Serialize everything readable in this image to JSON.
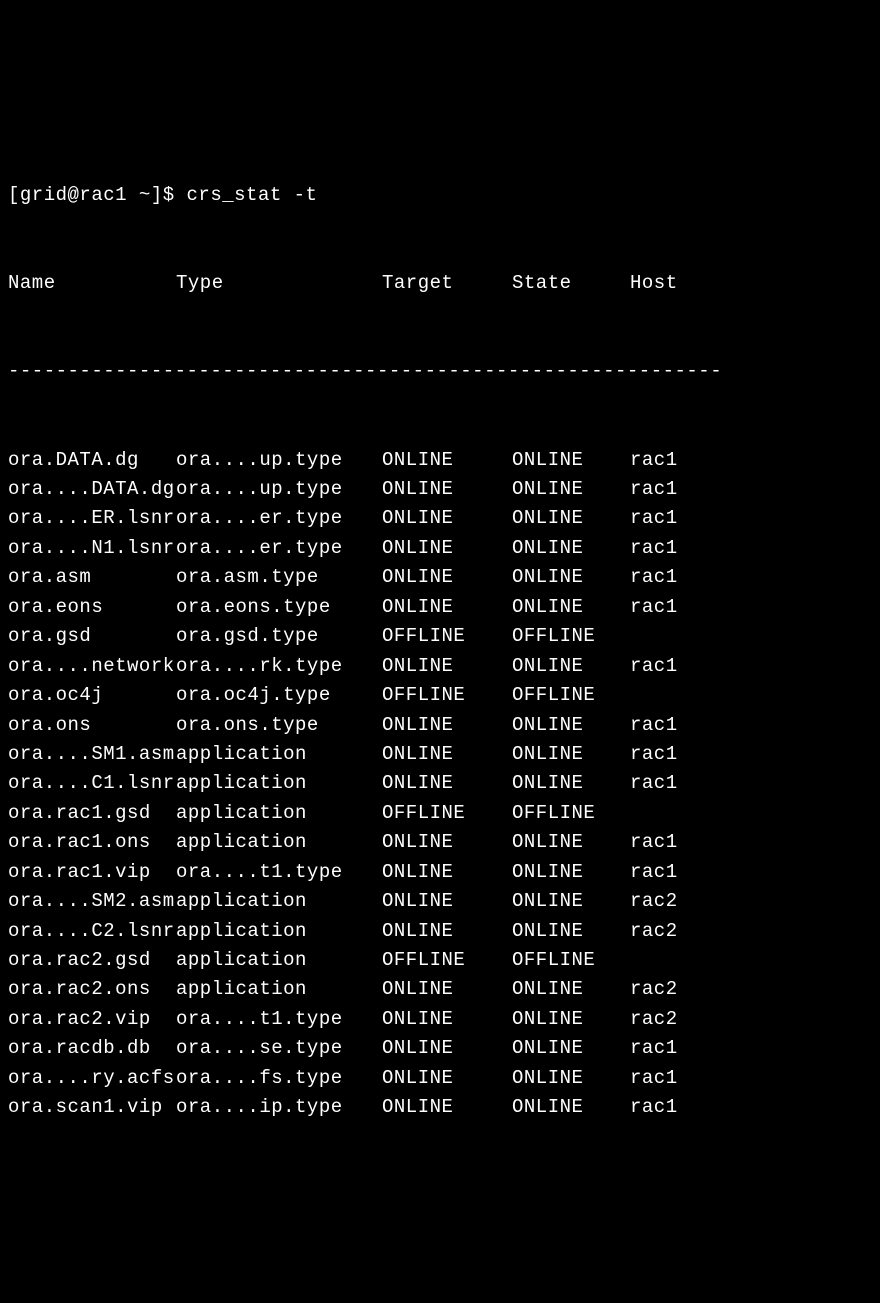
{
  "prompt": "[grid@rac1 ~]$ crs_stat -t",
  "headers": {
    "name": "Name",
    "type": "Type",
    "target": "Target",
    "state": "State",
    "host": "Host"
  },
  "divider": "------------------------------------------------------------",
  "rows": [
    {
      "name": "ora.DATA.dg",
      "type": "ora....up.type",
      "target": "ONLINE",
      "state": "ONLINE",
      "host": "rac1"
    },
    {
      "name": "ora....DATA.dg",
      "type": "ora....up.type",
      "target": "ONLINE",
      "state": "ONLINE",
      "host": "rac1"
    },
    {
      "name": "ora....ER.lsnr",
      "type": "ora....er.type",
      "target": "ONLINE",
      "state": "ONLINE",
      "host": "rac1"
    },
    {
      "name": "ora....N1.lsnr",
      "type": "ora....er.type",
      "target": "ONLINE",
      "state": "ONLINE",
      "host": "rac1"
    },
    {
      "name": "ora.asm",
      "type": "ora.asm.type",
      "target": "ONLINE",
      "state": "ONLINE",
      "host": "rac1"
    },
    {
      "name": "ora.eons",
      "type": "ora.eons.type",
      "target": "ONLINE",
      "state": "ONLINE",
      "host": "rac1"
    },
    {
      "name": "ora.gsd",
      "type": "ora.gsd.type",
      "target": "OFFLINE",
      "state": "OFFLINE",
      "host": ""
    },
    {
      "name": "ora....network",
      "type": "ora....rk.type",
      "target": "ONLINE",
      "state": "ONLINE",
      "host": "rac1"
    },
    {
      "name": "ora.oc4j",
      "type": "ora.oc4j.type",
      "target": "OFFLINE",
      "state": "OFFLINE",
      "host": ""
    },
    {
      "name": "ora.ons",
      "type": "ora.ons.type",
      "target": "ONLINE",
      "state": "ONLINE",
      "host": "rac1"
    },
    {
      "name": "ora....SM1.asm",
      "type": "application",
      "target": "ONLINE",
      "state": "ONLINE",
      "host": "rac1"
    },
    {
      "name": "ora....C1.lsnr",
      "type": "application",
      "target": "ONLINE",
      "state": "ONLINE",
      "host": "rac1"
    },
    {
      "name": "ora.rac1.gsd",
      "type": "application",
      "target": "OFFLINE",
      "state": "OFFLINE",
      "host": ""
    },
    {
      "name": "ora.rac1.ons",
      "type": "application",
      "target": "ONLINE",
      "state": "ONLINE",
      "host": "rac1"
    },
    {
      "name": "ora.rac1.vip",
      "type": "ora....t1.type",
      "target": "ONLINE",
      "state": "ONLINE",
      "host": "rac1"
    },
    {
      "name": "ora....SM2.asm",
      "type": "application",
      "target": "ONLINE",
      "state": "ONLINE",
      "host": "rac2"
    },
    {
      "name": "ora....C2.lsnr",
      "type": "application",
      "target": "ONLINE",
      "state": "ONLINE",
      "host": "rac2"
    },
    {
      "name": "ora.rac2.gsd",
      "type": "application",
      "target": "OFFLINE",
      "state": "OFFLINE",
      "host": ""
    },
    {
      "name": "ora.rac2.ons",
      "type": "application",
      "target": "ONLINE",
      "state": "ONLINE",
      "host": "rac2"
    },
    {
      "name": "ora.rac2.vip",
      "type": "ora....t1.type",
      "target": "ONLINE",
      "state": "ONLINE",
      "host": "rac2"
    },
    {
      "name": "ora.racdb.db",
      "type": "ora....se.type",
      "target": "ONLINE",
      "state": "ONLINE",
      "host": "rac1"
    },
    {
      "name": "ora....ry.acfs",
      "type": "ora....fs.type",
      "target": "ONLINE",
      "state": "ONLINE",
      "host": "rac1"
    },
    {
      "name": "ora.scan1.vip",
      "type": "ora....ip.type",
      "target": "ONLINE",
      "state": "ONLINE",
      "host": "rac1"
    }
  ]
}
